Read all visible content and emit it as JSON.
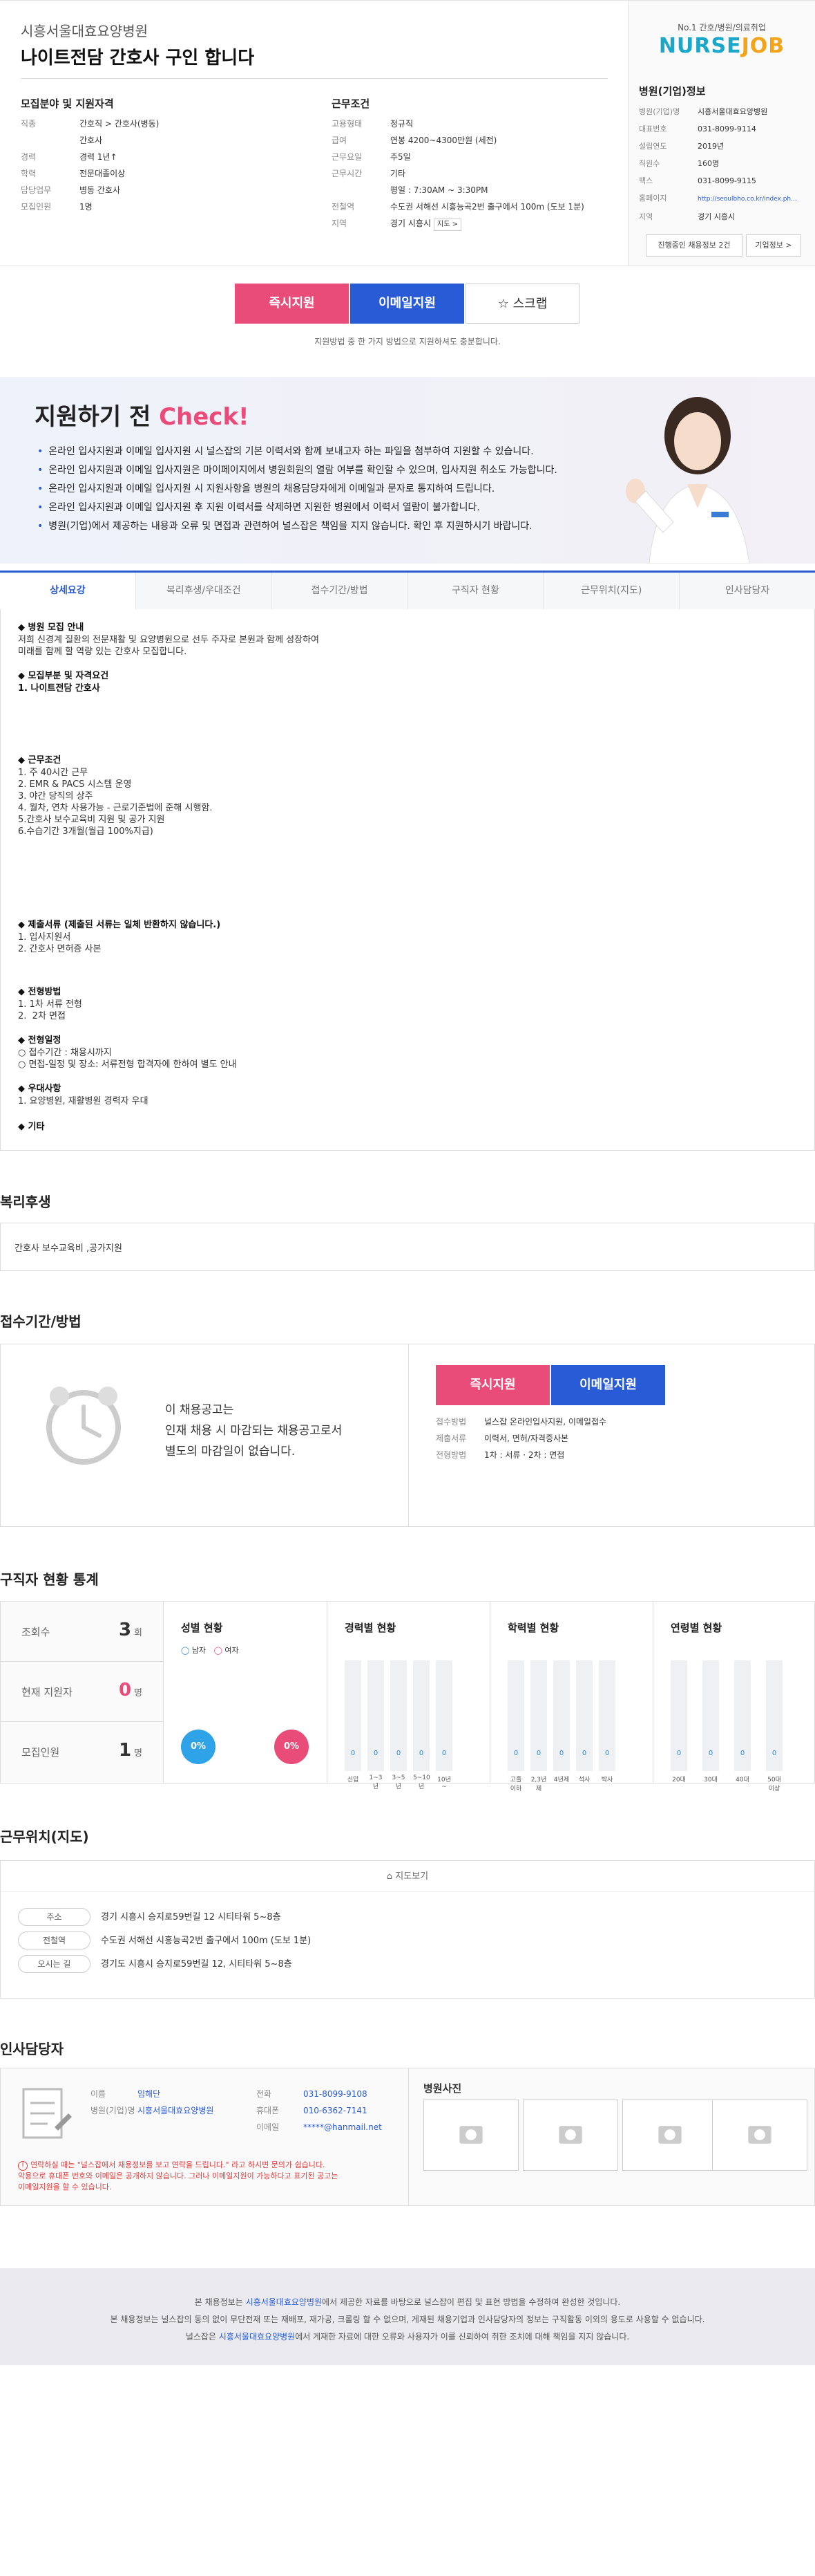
{
  "header": {
    "hospital": "시흥서울대효요양병원",
    "title": "나이트전담 간호사 구인 합니다"
  },
  "requirements": {
    "title": "모집분야 및 지원자격",
    "rows": [
      {
        "k": "직종",
        "v": "간호직 > 간호사(병동)"
      },
      {
        "k": "",
        "v": "간호사"
      },
      {
        "k": "경력",
        "v": "경력 1년↑"
      },
      {
        "k": "학력",
        "v": "전문대졸이상"
      },
      {
        "k": "담당업무",
        "v": "병동 간호사"
      },
      {
        "k": "모집인원",
        "v": "1명"
      }
    ]
  },
  "conditions": {
    "title": "근무조건",
    "rows": [
      {
        "k": "고용형태",
        "v": "정규직"
      },
      {
        "k": "급여",
        "v": "연봉 4200~4300만원 (세전)"
      },
      {
        "k": "근무요일",
        "v": "주5일"
      },
      {
        "k": "근무시간",
        "v": "기타"
      },
      {
        "k": "",
        "v": "평일 : 7:30AM ~ 3:30PM"
      },
      {
        "k": "전철역",
        "v": "수도권 서해선 시흥능곡2번 출구에서 100m (도보 1분)"
      },
      {
        "k": "지역",
        "v": "경기 시흥시"
      }
    ],
    "map_tag": "지도 >"
  },
  "company": {
    "logo_small": "No.1 간호/병원/의료취업",
    "logo_a": "NURSE",
    "logo_b": "JOB",
    "title": "병원(기업)정보",
    "rows": [
      {
        "k": "병원(기업)명",
        "v": "시흥서울대효요양병원"
      },
      {
        "k": "대표번호",
        "v": "031-8099-9114"
      },
      {
        "k": "설립연도",
        "v": "2019년"
      },
      {
        "k": "직원수",
        "v": "160명"
      },
      {
        "k": "팩스",
        "v": "031-8099-9115"
      },
      {
        "k": "홈페이지",
        "v": "http://seoulbho.co.kr/index.ph..."
      },
      {
        "k": "지역",
        "v": "경기 시흥시"
      }
    ],
    "btn_jobs": "진행중인 채용정보 2건",
    "btn_info": "기업정보 >"
  },
  "apply": {
    "now": "즉시지원",
    "email": "이메일지원",
    "scrap": "☆ 스크랩",
    "note": "지원방법 중 한 가지 방법으로 지원하셔도 충분합니다."
  },
  "check": {
    "title_a": "지원하기 전 ",
    "title_b": "Check!",
    "items": [
      "온라인 입사지원과 이메일 입사지원 시 널스잡의 기본 이력서와 함께 보내고자 하는 파일을 첨부하여 지원할 수 있습니다.",
      "온라인 입사지원과 이메일 입사지원은 마이페이지에서 병원회원의 열람 여부를 확인할 수 있으며, 입사지원 취소도 가능합니다.",
      "온라인 입사지원과 이메일 입사지원 시 지원사항을 병원의 채용담당자에게 이메일과 문자로 통지하여 드립니다.",
      "온라인 입사지원과 이메일 입사지원 후 지원 이력서를 삭제하면 지원한 병원에서 이력서 열람이 불가합니다.",
      "병원(기업)에서 제공하는 내용과 오류 및 면접과 관련하여 널스잡은 책임을 지지 않습니다. 확인 후 지원하시기 바랍니다."
    ]
  },
  "tabs": [
    "상세요강",
    "복리후생/우대조건",
    "접수기간/방법",
    "구직자 현황",
    "근무위치(지도)",
    "인사담당자"
  ],
  "detail": {
    "b1": "◆ 병원 모집 안내",
    "t1": "저희 신경계 질환의 전문재활 및 요양병원으로 선두 주자로 본원과 함께 성장하여\n미래를 함께 할 역량 있는 간호사 모집합니다.",
    "b2": "◆ 모집부분 및 자격요건",
    "b2b": "1. 나이트전담 간호사",
    "b3": "◆ 근무조건",
    "t3": "1. 주 40시간 근무\n2. EMR & PACS 시스템 운영\n3. 야간 당직의 상주\n4. 월차, 연차 사용가능 - 근로기준법에 준해 시행함.\n5.간호사 보수교육비 지원 및 공가 지원\n6.수습기간 3개월(월급 100%지급)",
    "b4": "◆ 제출서류 (제출된 서류는 일체 반환하지 않습니다.)",
    "t4": "1. 입사지원서\n2. 간호사 면허증 사본",
    "b5": "◆ 전형방법",
    "t5": "1. 1차 서류 전형\n2.  2차 면접",
    "b6": "◆ 전형일정",
    "t6": "○ 접수기간 : 채용시까지\n○ 면접-일정 및 장소: 서류전형 합격자에 한하여 별도 안내",
    "b7": "◆ 우대사항",
    "t7": "1. 요양병원, 재활병원 경력자 우대",
    "b8": "◆ 기타"
  },
  "welfare": {
    "title": "복리후생",
    "text": "간호사 보수교육비 ,공가지원"
  },
  "deadline": {
    "title": "접수기간/방법",
    "text": "이 채용공고는\n인재 채용 시 마감되는 채용공고로서\n별도의 마감일이 없습니다.",
    "btn_now": "즉시지원",
    "btn_email": "이메일지원",
    "rows": [
      {
        "k": "접수방법",
        "v": "널스잡 온라인입사지원, 이메일접수"
      },
      {
        "k": "제출서류",
        "v": "이력서, 면허/자격증사본"
      },
      {
        "k": "전형방법",
        "v": "1차 : 서류 · 2차 : 면접"
      }
    ]
  },
  "stats": {
    "title": "구직자 현황 통계",
    "rows": [
      {
        "k": "조회수",
        "v": "3",
        "u": "회"
      },
      {
        "k": "현재 지원자",
        "v": "0",
        "u": "명"
      },
      {
        "k": "모집인원",
        "v": "1",
        "u": "명"
      }
    ],
    "gender": {
      "title": "성별 현황",
      "male": "남자",
      "female": "여자",
      "male_pct": "0%",
      "female_pct": "0%"
    },
    "career": {
      "title": "경력별 현황",
      "labels": [
        "신입",
        "1~3년",
        "3~5년",
        "5~10년",
        "10년~"
      ],
      "values": [
        0,
        0,
        0,
        0,
        0
      ]
    },
    "edu": {
      "title": "학력별 현황",
      "labels": [
        "고졸이하",
        "2,3년제",
        "4년제",
        "석사",
        "박사"
      ],
      "values": [
        0,
        0,
        0,
        0,
        0
      ]
    },
    "age": {
      "title": "연령별 현황",
      "labels": [
        "20대",
        "30대",
        "40대",
        "50대이상"
      ],
      "values": [
        0,
        0,
        0,
        0
      ]
    }
  },
  "map": {
    "title": "근무위치(지도)",
    "toggle": "지도보기",
    "rows": [
      {
        "k": "주소",
        "v": "경기 시흥시 승지로59번길 12 시티타워 5~8층"
      },
      {
        "k": "전철역",
        "v": "수도권 서해선 시흥능곡2번 출구에서 100m (도보 1분)"
      },
      {
        "k": "오시는 길",
        "v": "경기도 시흥시 승지로59번길 12, 시티타워 5~8층"
      }
    ]
  },
  "contact": {
    "title": "인사담당자",
    "rows_a": [
      {
        "k": "이름",
        "v": "임해단"
      },
      {
        "k": "병원(기업)명",
        "v": "시흥서울대효요양병원"
      }
    ],
    "rows_b": [
      {
        "k": "전화",
        "v": "031-8099-9108"
      },
      {
        "k": "휴대폰",
        "v": "010-6362-7141"
      },
      {
        "k": "이메일",
        "v": "*****@hanmail.net"
      }
    ],
    "warn": "연락하실 때는 \"널스잡에서 채용정보를 보고 연락을 드립니다.\" 라고 하시면 문의가 쉽습니다.\n악용으로 휴대폰 번호와 이메일은 공개하지 않습니다. 그러나 이메일지원이 가능하다고 표기된 공고는\n이메일지원을 할 수 있습니다.",
    "photo_title": "병원사진"
  },
  "footer": {
    "l1a": "본 채용정보는 ",
    "l1b": "시흥서울대효요양병원",
    "l1c": "에서 제공한 자료를 바탕으로 널스잡이 편집 및 표현 방법을 수정하여 완성한 것입니다.",
    "l2": "본 채용정보는 널스잡의 동의 없이 무단전재 또는 재배포, 재가공, 크롤링 할 수 없으며, 게재된 채용기업과 인사담당자의 정보는 구직활동 이외의 용도로 사용할 수 없습니다.",
    "l3a": "널스잡은 ",
    "l3b": "시흥서울대효요양병원",
    "l3c": "에서 게재한 자료에 대한 오류와 사용자가 이를 신뢰하여 취한 조치에 대해 책임을 지지 않습니다."
  },
  "colors": {
    "accent_pink": "#ea4c7a",
    "accent_blue": "#2a5bd7"
  }
}
